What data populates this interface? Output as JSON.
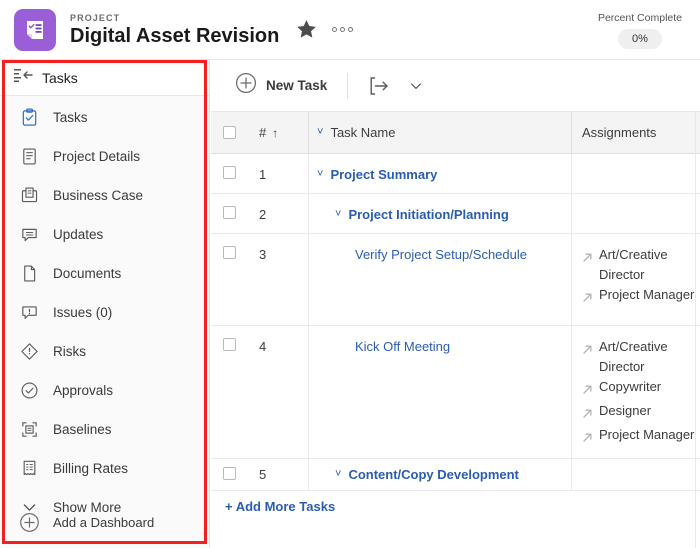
{
  "header": {
    "eyebrow": "PROJECT",
    "title": "Digital Asset Revision",
    "logo_icon": "project-checklist-icon",
    "star_icon": "star-filled-icon",
    "overflow_icon": "ellipsis-icon",
    "percent_complete_label": "Percent Complete",
    "percent_complete_value": "0%",
    "accent_color": "#9a5ed6"
  },
  "sidebar": {
    "header_label": "Tasks",
    "header_icon": "collapse-menu-icon",
    "items": [
      {
        "label": "Tasks",
        "icon": "clipboard-check-icon",
        "active": true
      },
      {
        "label": "Project Details",
        "icon": "document-lines-icon",
        "active": false
      },
      {
        "label": "Business Case",
        "icon": "briefcase-doc-icon",
        "active": false
      },
      {
        "label": "Updates",
        "icon": "comment-lines-icon",
        "active": false
      },
      {
        "label": "Documents",
        "icon": "page-icon",
        "active": false
      },
      {
        "label": "Issues (0)",
        "icon": "comment-alert-icon",
        "active": false
      },
      {
        "label": "Risks",
        "icon": "diamond-alert-icon",
        "active": false
      },
      {
        "label": "Approvals",
        "icon": "circle-check-icon",
        "active": false
      },
      {
        "label": "Baselines",
        "icon": "baseline-frame-icon",
        "active": false
      },
      {
        "label": "Billing Rates",
        "icon": "receipt-icon",
        "active": false
      }
    ],
    "show_more_label": "Show More",
    "show_more_icon": "chevron-down-icon",
    "add_dashboard_label": "Add a Dashboard",
    "add_dashboard_icon": "plus-circle-icon"
  },
  "toolbar": {
    "new_task_label": "New Task",
    "new_task_icon": "plus-circle-icon",
    "export_icon": "convert-arrow-icon",
    "caret_icon": "chevron-down-icon"
  },
  "table": {
    "columns": {
      "select_all": "",
      "number": "#",
      "number_sort_icon": "↑",
      "task_name": "Task Name",
      "assignments": "Assignments"
    },
    "rows": [
      {
        "num": "1",
        "name": "Project Summary",
        "indent": 1,
        "has_caret": true,
        "bold": true,
        "assignments": []
      },
      {
        "num": "2",
        "name": "Project Initiation/Planning",
        "indent": 2,
        "has_caret": true,
        "bold": true,
        "assignments": []
      },
      {
        "num": "3",
        "name": "Verify Project Setup/Schedule",
        "indent": 3,
        "has_caret": false,
        "bold": false,
        "assignments": [
          "Art/Creative Director",
          "Project Manager"
        ]
      },
      {
        "num": "4",
        "name": "Kick Off Meeting",
        "indent": 3,
        "has_caret": false,
        "bold": false,
        "assignments": [
          "Art/Creative Director",
          "Copywriter",
          "Designer",
          "Project Manager"
        ]
      },
      {
        "num": "5",
        "name": "Content/Copy Development",
        "indent": 2,
        "has_caret": true,
        "bold": true,
        "assignments": []
      }
    ],
    "add_more_label": "+ Add More Tasks"
  },
  "annotation": {
    "color": "#f42020"
  }
}
